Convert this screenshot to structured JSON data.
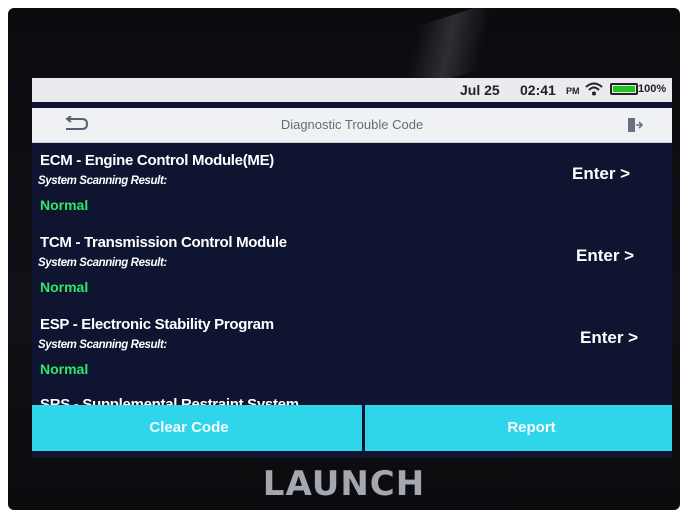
{
  "status_bar": {
    "date": "Jul 25",
    "time": "02:41",
    "ampm": "PM",
    "battery": "100%",
    "battery_level": 1.0
  },
  "header": {
    "title": "Diagnostic Trouble Code"
  },
  "modules": [
    {
      "name": "ECM - Engine Control Module(ME)",
      "scan_label": "System Scanning Result:",
      "status": "Normal",
      "enter_label": "Enter >"
    },
    {
      "name": "TCM - Transmission Control Module",
      "scan_label": "System Scanning Result:",
      "status": "Normal",
      "enter_label": "Enter >"
    },
    {
      "name": "ESP - Electronic Stability Program",
      "scan_label": "System Scanning Result:",
      "status": "Normal",
      "enter_label": "Enter >"
    },
    {
      "name": "SRS - Supplemental Restraint System"
    }
  ],
  "actions": {
    "clear_code": "Clear Code",
    "report": "Report"
  },
  "brand": "LAUNCH",
  "colors": {
    "screen_bg": "#0f1530",
    "status_ok": "#2ee66a",
    "action_button": "#2fd5ea"
  }
}
